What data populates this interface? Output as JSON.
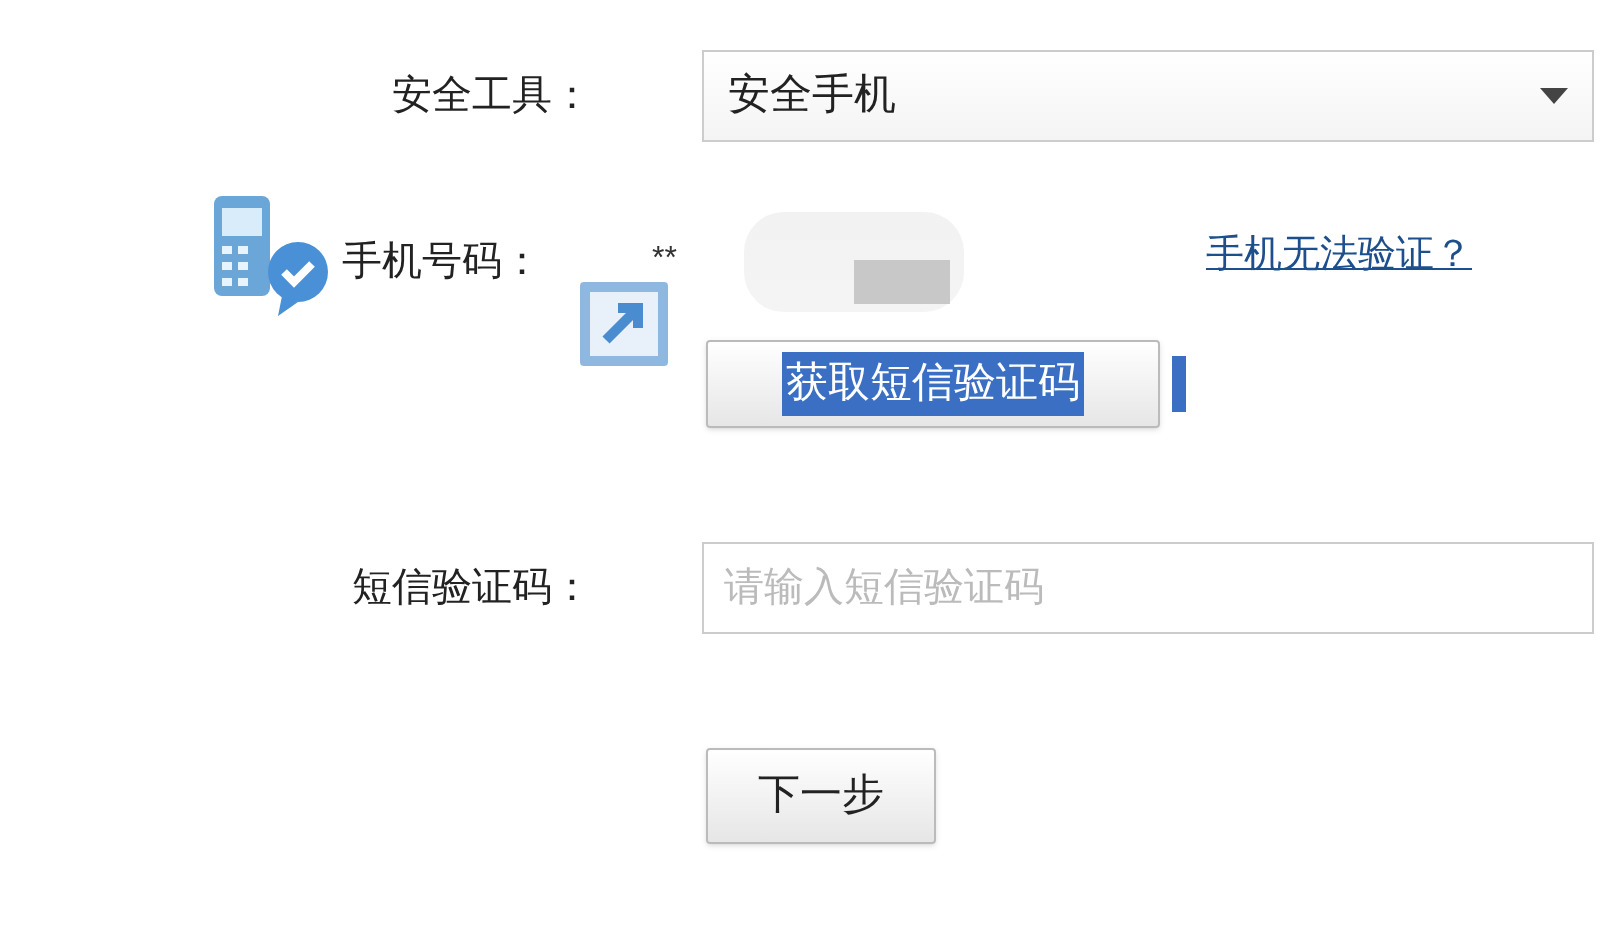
{
  "security_tool": {
    "label": "安全工具：",
    "value": "安全手机"
  },
  "phone": {
    "label": "手机号码：",
    "masked_value": "**",
    "link": "手机无法验证？"
  },
  "sms_button": {
    "label": "获取短信验证码",
    "text_selected": true
  },
  "sms_code": {
    "label": "短信验证码：",
    "placeholder": "请输入短信验证码"
  },
  "next_button": {
    "label": "下一步"
  }
}
